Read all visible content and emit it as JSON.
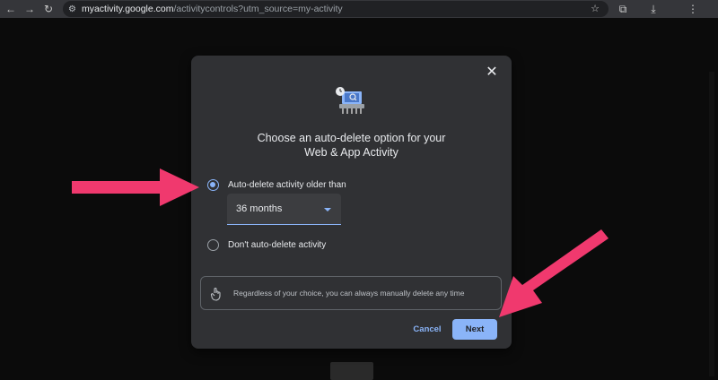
{
  "browser": {
    "nav": {
      "back": "←",
      "forward": "→",
      "reload": "↻"
    },
    "url_host": "myactivity.google.com",
    "url_path": "/activitycontrols?utm_source=my-activity",
    "icons": [
      "star-icon",
      "extensions-icon",
      "download-icon",
      "menu-icon"
    ]
  },
  "dialog": {
    "close_label": "✕",
    "heading_line1": "Choose an auto-delete option for your",
    "heading_line2": "Web & App Activity",
    "option_auto_delete": "Auto-delete activity older than",
    "selected_period": "36 months",
    "option_no_delete": "Don't auto-delete activity",
    "info_text": "Regardless of your choice, you can always manually delete any time",
    "cancel_label": "Cancel",
    "next_label": "Next"
  },
  "colors": {
    "accent": "#8ab4f8",
    "dialog_bg": "#303134",
    "annotation_arrow": "#f0396e"
  }
}
